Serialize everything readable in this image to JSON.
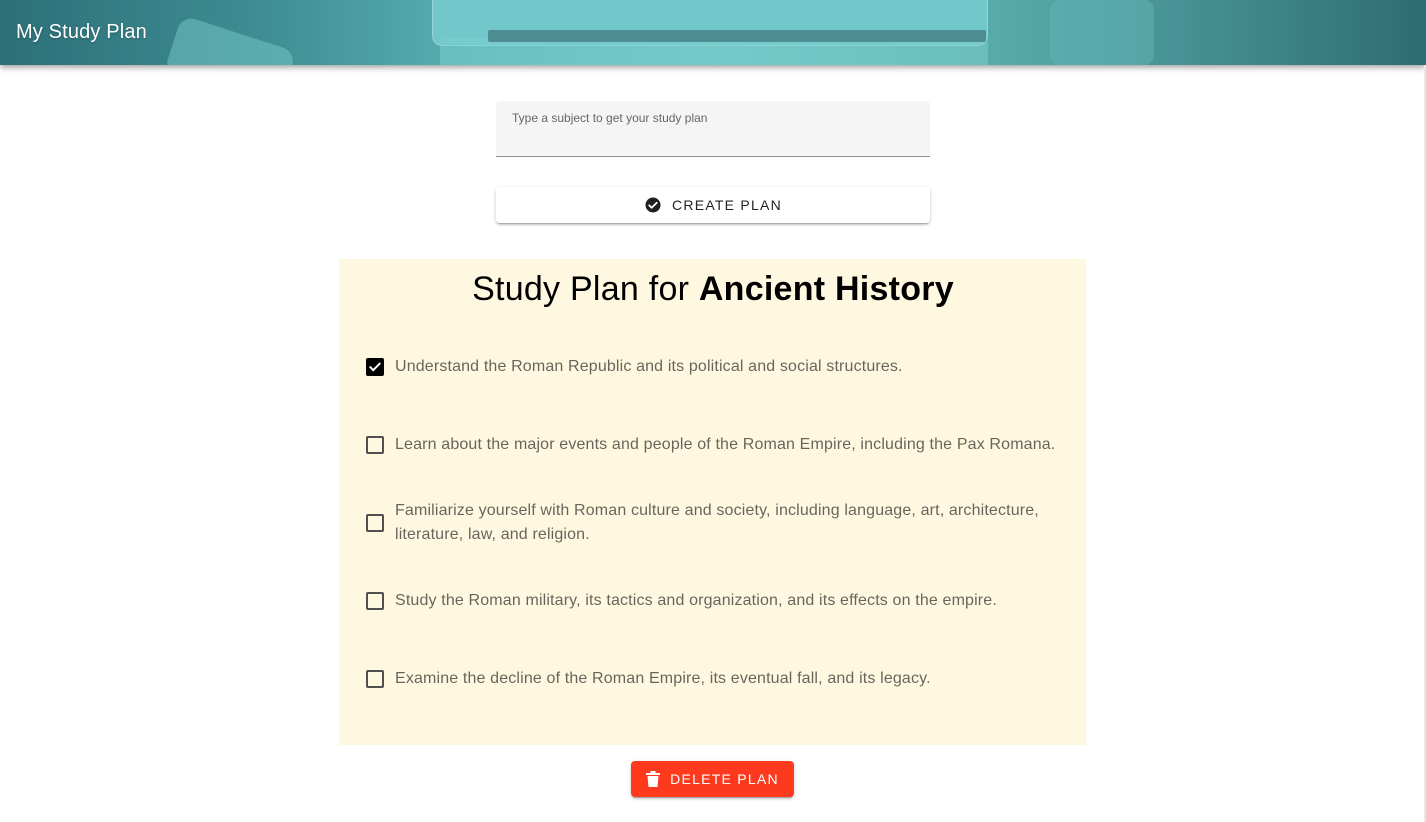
{
  "app": {
    "title": "My Study Plan"
  },
  "subject_input": {
    "label": "Type a subject to get your study plan",
    "value": ""
  },
  "create_button": {
    "label": "CREATE PLAN",
    "icon": "check-circle-icon"
  },
  "plan": {
    "title_prefix": "Study Plan for",
    "subject": "Ancient History",
    "background": "#fff8e1",
    "tasks": [
      {
        "text": "Understand the Roman Republic and its political and social structures.",
        "checked": true
      },
      {
        "text": "Learn about the major events and people of the Roman Empire, including the Pax Romana.",
        "checked": false
      },
      {
        "text": "Familiarize yourself with Roman culture and society, including language, art, architecture, literature, law, and religion.",
        "checked": false
      },
      {
        "text": "Study the Roman military, its tactics and organization, and its effects on the empire.",
        "checked": false
      },
      {
        "text": "Examine the decline of the Roman Empire, its eventual fall, and its legacy.",
        "checked": false
      }
    ]
  },
  "delete_button": {
    "label": "DELETE PLAN",
    "icon": "trash-icon",
    "color": "#fe3a1e"
  }
}
